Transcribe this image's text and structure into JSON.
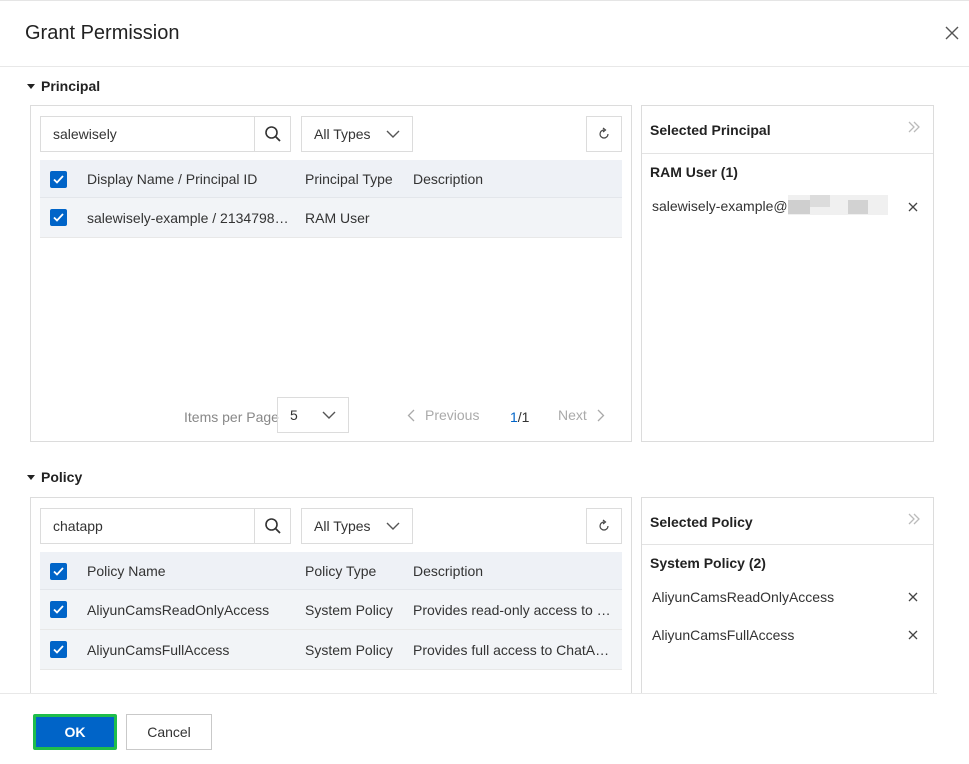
{
  "dialog": {
    "title": "Grant Permission"
  },
  "principal": {
    "section_title": "Principal",
    "search_value": "salewisely",
    "type_filter": "All Types",
    "columns": [
      "Display Name / Principal ID",
      "Principal Type",
      "Description"
    ],
    "rows": [
      {
        "name": "salewisely-example / 21347988…",
        "type": "RAM User",
        "description": ""
      }
    ],
    "pager": {
      "items_per_page_label": "Items per Page",
      "items_per_page": "5",
      "previous": "Previous",
      "current": "1",
      "total": "/1",
      "next": "Next"
    },
    "selected": {
      "title": "Selected Principal",
      "group": "RAM User (1)",
      "items": [
        "salewisely-example@5"
      ]
    }
  },
  "policy": {
    "section_title": "Policy",
    "search_value": "chatapp",
    "type_filter": "All Types",
    "columns": [
      "Policy Name",
      "Policy Type",
      "Description"
    ],
    "rows": [
      {
        "name": "AliyunCamsReadOnlyAccess",
        "type": "System Policy",
        "description": "Provides read-only access to Ch…"
      },
      {
        "name": "AliyunCamsFullAccess",
        "type": "System Policy",
        "description": "Provides full access to ChatAPP …"
      }
    ],
    "selected": {
      "title": "Selected Policy",
      "group": "System Policy (2)",
      "items": [
        "AliyunCamsReadOnlyAccess",
        "AliyunCamsFullAccess"
      ]
    }
  },
  "footer": {
    "ok": "OK",
    "cancel": "Cancel"
  },
  "colors": {
    "primary": "#0064c8",
    "highlight": "#1fbd4b"
  }
}
